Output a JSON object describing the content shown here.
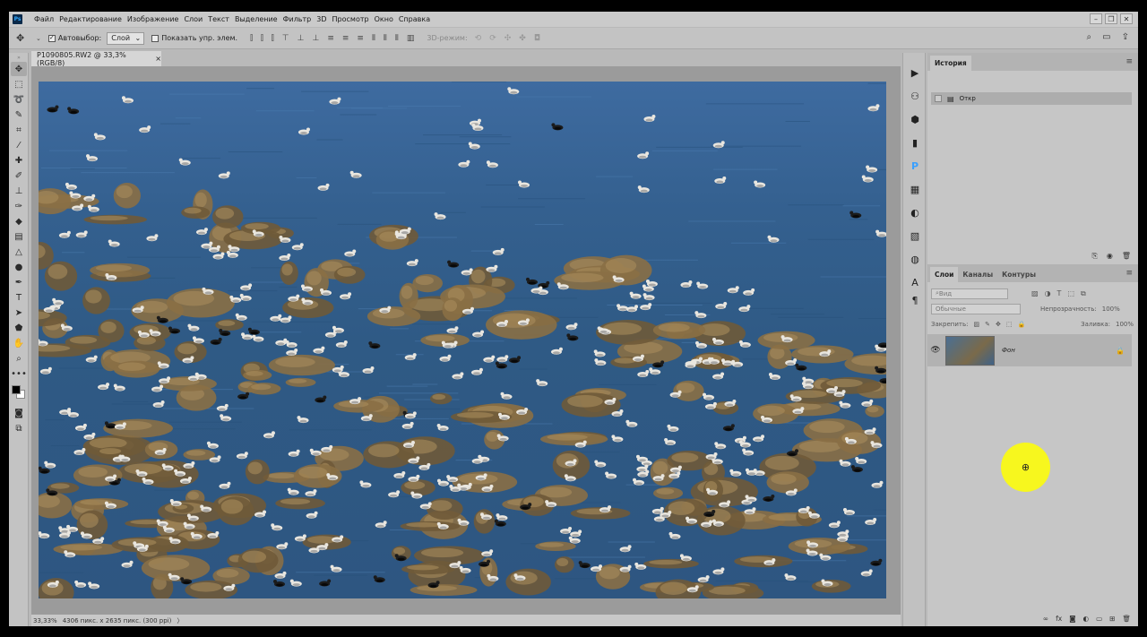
{
  "app": {
    "logo": "Ps"
  },
  "menu": [
    "Файл",
    "Редактирование",
    "Изображение",
    "Слои",
    "Текст",
    "Выделение",
    "Фильтр",
    "3D",
    "Просмотр",
    "Окно",
    "Справка"
  ],
  "window_controls": {
    "minimize": "–",
    "restore": "❐",
    "close": "✕"
  },
  "options": {
    "autoselect_label": "Автовыбор:",
    "autoselect_value": "Слой",
    "show_transform_label": "Показать упр. элем.",
    "mode3d_label": "3D-режим:"
  },
  "document": {
    "tab_title": "P1090805.RW2 @ 33,3% (RGB/8)",
    "tab_close": "×",
    "zoom": "33,33%",
    "size_info": "4306 пикс. x 2635 пикс. (300 ppi)",
    "status_arrow": "〉"
  },
  "history": {
    "tab": "История",
    "item": "Откр"
  },
  "layers": {
    "tabs": [
      "Слои",
      "Каналы",
      "Контуры"
    ],
    "filter_placeholder": "Вид",
    "blend_mode": "Обычные",
    "opacity_label": "Непрозрачность:",
    "opacity_value": "100%",
    "lock_label": "Закрепить:",
    "fill_label": "Заливка:",
    "fill_value": "100%",
    "layer_name": "Фон"
  },
  "colors": {
    "accent_highlight": "#f2f200",
    "water": "#34608f",
    "rock": "#8a6f45"
  }
}
